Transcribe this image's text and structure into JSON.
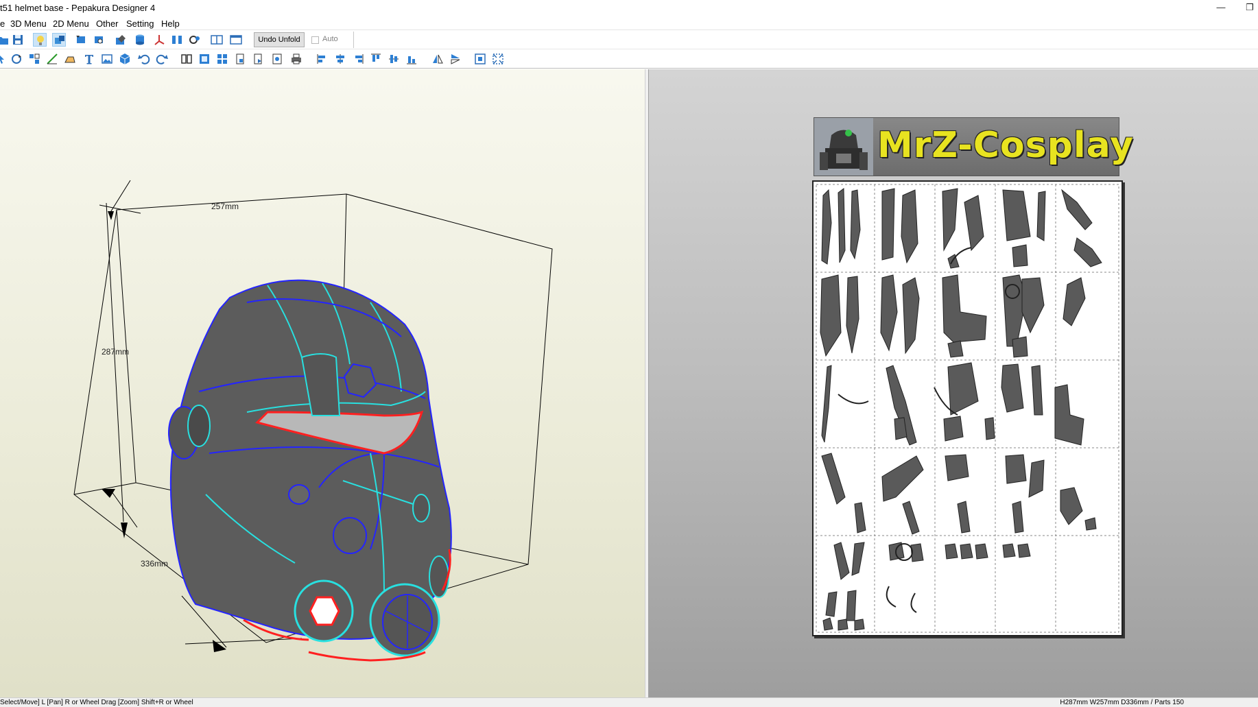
{
  "window": {
    "title": "t51 helmet base - Pepakura Designer 4",
    "minimize_glyph": "—",
    "restore_glyph": "❐"
  },
  "menu": {
    "items": [
      "e",
      "3D Menu",
      "2D Menu",
      "Other",
      "Setting",
      "Help"
    ]
  },
  "toolbar": {
    "undo_unfold_label": "Undo Unfold",
    "auto_label": "Auto",
    "auto_checked": false
  },
  "view3d": {
    "dimensions": {
      "width_label": "257mm",
      "height_label": "287mm",
      "depth_label": "336mm"
    },
    "colors": {
      "background_top": "#f8f8ef",
      "background_bottom": "#e0e0c8",
      "model_fill": "#5c5c5c",
      "edge_blue": "#2424ff",
      "edge_cyan": "#28e0e0",
      "edge_red": "#ff2020"
    }
  },
  "view2d": {
    "banner_text": "MrZ-Cosplay",
    "colors": {
      "banner_text": "#e8e320",
      "part_fill": "#5a5a5a"
    }
  },
  "status": {
    "left_text": "Select/Move] L [Pan] R or Wheel Drag [Zoom] Shift+R or Wheel",
    "right_text": "H287mm W257mm D336mm / Parts 150"
  }
}
